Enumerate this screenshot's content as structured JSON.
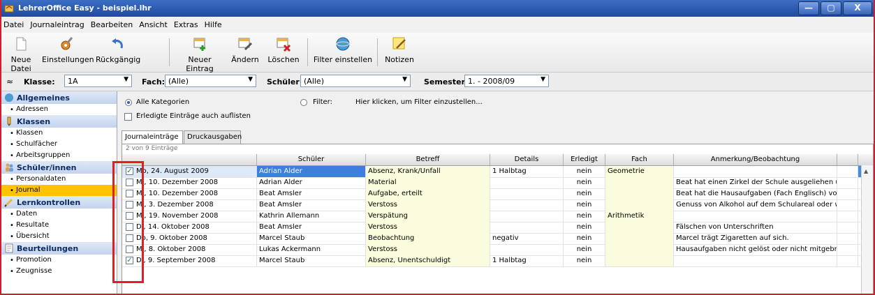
{
  "window": {
    "title": "LehrerOffice Easy - beispiel.lhr",
    "min_label": "—",
    "max_label": "▢",
    "close_label": "X"
  },
  "menu": [
    "Datei",
    "Journaleintrag",
    "Bearbeiten",
    "Ansicht",
    "Extras",
    "Hilfe"
  ],
  "toolbar": {
    "neue_datei": "Neue Datei",
    "einstellungen": "Einstellungen",
    "rueckgaengig": "Rückgängig",
    "neuer_eintrag": "Neuer Eintrag",
    "aendern": "Ändern",
    "loeschen": "Löschen",
    "filter": "Filter einstellen",
    "notizen": "Notizen"
  },
  "filterbar": {
    "collapse_glyph": "≈",
    "klasse_label": "Klasse:",
    "klasse_value": "1A",
    "fach_label": "Fach:",
    "fach_value": "(Alle)",
    "schueler_label": "Schüler:",
    "schueler_value": "(Alle)",
    "semester_label": "Semester:",
    "semester_value": "1. - 2008/09"
  },
  "sidebar": {
    "groups": [
      {
        "title": "Allgemeines",
        "items": [
          "Adressen"
        ]
      },
      {
        "title": "Klassen",
        "items": [
          "Klassen",
          "Schulfächer",
          "Arbeitsgruppen"
        ]
      },
      {
        "title": "Schüler/innen",
        "items": [
          "Personaldaten",
          "Journal"
        ]
      },
      {
        "title": "Lernkontrollen",
        "items": [
          "Daten",
          "Resultate",
          "Übersicht"
        ]
      },
      {
        "title": "Beurteilungen",
        "items": [
          "Promotion",
          "Zeugnisse"
        ]
      }
    ],
    "selected": "Journal"
  },
  "options": {
    "alle_kategorien": "Alle Kategorien",
    "erledigte": "Erledigte Einträge auch auflisten",
    "filter_label": "Filter:",
    "filter_hint": "Hier klicken, um Filter einzustellen..."
  },
  "tabs": [
    "Journaleinträge",
    "Druckausgaben"
  ],
  "table": {
    "count": "2 von 9 Einträge",
    "columns": [
      "",
      "Schüler",
      "Betreff",
      "Details",
      "Erledigt",
      "Fach",
      "Anmerkung/Beobachtung"
    ],
    "rows": [
      {
        "checked": true,
        "date": "Mo, 24. August 2009",
        "schueler": "Adrian Alder",
        "betreff": "Absenz, Krank/Unfall",
        "details": "1 Halbtag",
        "erledigt": "nein",
        "fach": "Geometrie",
        "anmerkung": ""
      },
      {
        "checked": false,
        "date": "Mi, 10. Dezember 2008",
        "schueler": "Adrian Alder",
        "betreff": "Material",
        "details": "",
        "erledigt": "nein",
        "fach": "",
        "anmerkung": "Beat hat einen Zirkel der Schule ausgeliehen u..."
      },
      {
        "checked": false,
        "date": "Mi, 10. Dezember 2008",
        "schueler": "Beat Amsler",
        "betreff": "Aufgabe, erteilt",
        "details": "",
        "erledigt": "nein",
        "fach": "",
        "anmerkung": "Beat hat die Hausaufgaben (Fach Englisch) vo..."
      },
      {
        "checked": false,
        "date": "Mi, 3. Dezember 2008",
        "schueler": "Beat Amsler",
        "betreff": "Verstoss",
        "details": "",
        "erledigt": "nein",
        "fach": "",
        "anmerkung": "Genuss von Alkohol auf dem Schulareal oder w..."
      },
      {
        "checked": false,
        "date": "Mi, 19. November 2008",
        "schueler": "Kathrin Allemann",
        "betreff": "Verspätung",
        "details": "",
        "erledigt": "nein",
        "fach": "Arithmetik",
        "anmerkung": ""
      },
      {
        "checked": false,
        "date": "Di, 14. Oktober 2008",
        "schueler": "Beat Amsler",
        "betreff": "Verstoss",
        "details": "",
        "erledigt": "nein",
        "fach": "",
        "anmerkung": "Fälschen von Unterschriften"
      },
      {
        "checked": false,
        "date": "Do, 9. Oktober 2008",
        "schueler": "Marcel Staub",
        "betreff": "Beobachtung",
        "details": "negativ",
        "erledigt": "nein",
        "fach": "",
        "anmerkung": "Marcel trägt Zigaretten auf sich."
      },
      {
        "checked": false,
        "date": "Mi, 8. Oktober 2008",
        "schueler": "Lukas Ackermann",
        "betreff": "Verstoss",
        "details": "",
        "erledigt": "nein",
        "fach": "",
        "anmerkung": "Hausaufgaben nicht gelöst oder nicht mitgebr..."
      },
      {
        "checked": true,
        "date": "Di, 9. September 2008",
        "schueler": "Marcel Staub",
        "betreff": "Absenz, Unentschuldigt",
        "details": "1 Halbtag",
        "erledigt": "nein",
        "fach": "",
        "anmerkung": ""
      }
    ]
  }
}
